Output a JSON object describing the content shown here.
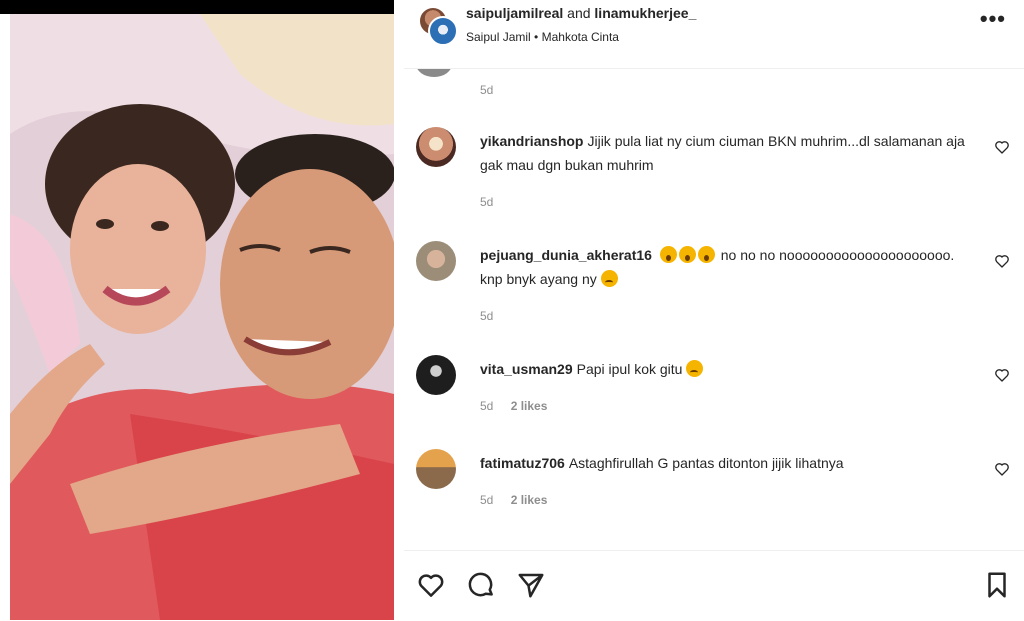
{
  "header": {
    "user1": "saipuljamilreal",
    "joiner": "and",
    "user2": "linamukherjee_",
    "subtitle_author": "Saipul Jamil",
    "subtitle_sep": "•",
    "subtitle_song": "Mahkota Cinta",
    "more_icon": "more-horizontal-icon"
  },
  "partial_comment": {
    "age": "5d"
  },
  "comments": [
    {
      "user": "yikandrianshop",
      "text": "Jijik pula liat ny cium ciuman BKN muhrim...dl salamanan aja gak mau dgn bukan muhrim",
      "age": "5d",
      "likes": ""
    },
    {
      "user": "pejuang_dunia_akherat16",
      "text_after_emoji": "no no no nooooooooooooooooooooo. knp bnyk ayang ny",
      "age": "5d",
      "likes": ""
    },
    {
      "user": "vita_usman29",
      "text": "Papi ipul kok gitu",
      "age": "5d",
      "likes": "2 likes"
    },
    {
      "user": "fatimatuz706",
      "text": "Astaghfirullah G pantas ditonton jijik lihatnya",
      "age": "5d",
      "likes": "2 likes"
    }
  ],
  "actions": {
    "like_icon": "heart-icon",
    "comment_icon": "comment-icon",
    "share_icon": "send-icon",
    "save_icon": "bookmark-icon"
  },
  "colors": {
    "text": "#262626",
    "muted": "#8e8e8e",
    "border": "#efefef"
  }
}
